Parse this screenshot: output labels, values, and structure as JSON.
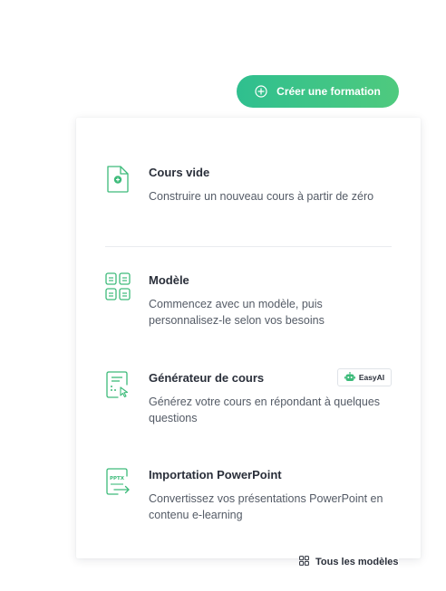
{
  "header": {
    "create_button_label": "Créer une formation",
    "create_button_icon": "plus-circle-icon"
  },
  "dropdown": {
    "options": [
      {
        "icon": "document-plus-icon",
        "title": "Cours vide",
        "description": "Construire un nouveau cours à partir de zéro"
      },
      {
        "icon": "template-grid-icon",
        "title": "Modèle",
        "description": "Commencez avec un modèle, puis personnalisez-le selon vos besoins"
      },
      {
        "icon": "generator-form-icon",
        "title": "Générateur de cours",
        "description": "Générez votre cours en répondant à quelques questions",
        "badge": {
          "icon": "robot-icon",
          "label": "EasyAI"
        }
      },
      {
        "icon": "pptx-import-icon",
        "title": "Importation PowerPoint",
        "description": "Convertissez vos présentations PowerPoint en contenu e-learning",
        "icon_text": "PPTX"
      }
    ]
  },
  "footer": {
    "all_models_label": "Tous les modèles",
    "all_models_icon": "grid-icon"
  },
  "colors": {
    "accent_start": "#2fbf8f",
    "accent_end": "#4fca7e",
    "icon_green": "#3dbb7a",
    "text_dark": "#2a2f3a",
    "text_muted": "#545b66"
  }
}
